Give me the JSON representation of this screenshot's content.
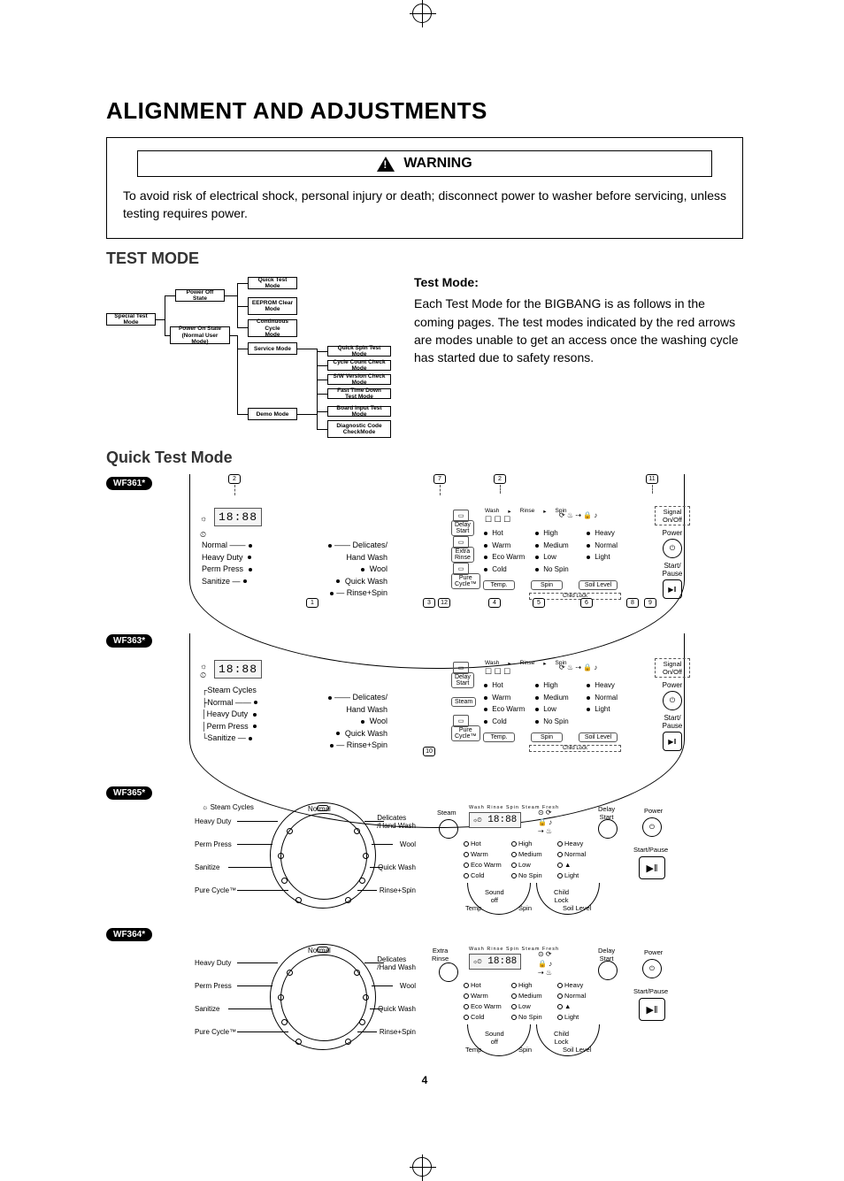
{
  "page": {
    "title": "ALIGNMENT AND ADJUSTMENTS",
    "warning_label": "WARNING",
    "warning_text": "To avoid risk of electrical shock, personal injury or death; disconnect power to washer before servicing, unless testing requires power.",
    "page_number": "4"
  },
  "sections": {
    "test_mode_heading": "TEST MODE",
    "quick_test_heading": "Quick Test Mode",
    "test_mode_sub": "Test Mode:",
    "test_mode_body": "Each Test Mode for the BIGBANG is as follows in the coming pages.  The test modes indicated by the red arrows are modes unable to get an access once the washing cycle has started due to safety resons."
  },
  "flow": {
    "special": "Special Test Mode",
    "power_off": "Power Off State",
    "power_on": "Power On State\n(Normal User Mode)",
    "quick": "Quick Test Mode",
    "eeprom": "EEPROM Clear\nMode",
    "continuous": "Continuous Cycle\nMode",
    "service": "Service Mode",
    "demo": "Demo Mode",
    "spin": "Quick Spin Test Mode",
    "cycle_count": "Cycle Count Check Mode",
    "sw_version": "S/W Version Check Mode",
    "fast_time": "Fast Time Down Test Mode",
    "board_input": "Board Input Test Mode",
    "diag": "Diagnostic Code\nCheckMode"
  },
  "models": {
    "m1": "WF361*",
    "m2": "WF363*",
    "m3": "WF365*",
    "m4": "WF364*"
  },
  "seg_display": "18:88",
  "cycles_left_a": [
    "Normal",
    "Heavy Duty",
    "Perm Press",
    "Sanitize"
  ],
  "cycles_right_a": [
    "Delicates/\nHand Wash",
    "Wool",
    "Quick Wash",
    "Rinse+Spin"
  ],
  "cycles_left_b": [
    "Steam Cycles",
    "Normal",
    "Heavy Duty",
    "Perm Press",
    "Sanitize"
  ],
  "knob_labels_c": {
    "top": "Steam Cycles",
    "left": [
      "Heavy Duty",
      "Perm Press",
      "Sanitize",
      "Pure Cycle™"
    ],
    "center": "Normal",
    "right": [
      "Delicates\n/Hand Wash",
      "Wool",
      "Quick Wash",
      "Rinse+Spin"
    ]
  },
  "knob_labels_d": {
    "left": [
      "Heavy Duty",
      "Perm Press",
      "Sanitize",
      "Pure Cycle™"
    ],
    "center": "Normal",
    "right": [
      "Delicates\n/Hand Wash",
      "Wool",
      "Quick Wash",
      "Rinse+Spin"
    ]
  },
  "right1": {
    "delay": "Delay\nStart",
    "extra_rinse": "Extra\nRinse",
    "pure_cycle": "Pure\nCycle™",
    "steam": "Steam",
    "proc": [
      "Wash",
      "Rinse",
      "Spin"
    ],
    "temp_col": [
      "Hot",
      "Warm",
      "Eco Warm",
      "Cold"
    ],
    "spin_col": [
      "High",
      "Medium",
      "Low",
      "No Spin"
    ],
    "soil_col": [
      "Heavy",
      "Normal",
      "Light"
    ],
    "temp_btn": "Temp.",
    "spin_btn": "Spin",
    "soil_btn": "Soil Level",
    "signal": "Signal\nOn/Off",
    "power": "Power",
    "start": "Start/\nPause",
    "child": "Child Lock"
  },
  "right2": {
    "extra_rinse": "Extra\nRinse",
    "steam": "Steam",
    "delay": "Delay\nStart",
    "power": "Power",
    "start": "Start/Pause",
    "temp": "Temp.",
    "spin": "Spin",
    "soil": "Soil Level",
    "sound": "Sound\noff",
    "child": "Child\nLock",
    "temp_opts": [
      "Hot",
      "Warm",
      "Eco Warm",
      "Cold"
    ],
    "spin_opts": [
      "High",
      "Medium",
      "Low",
      "No Spin"
    ],
    "soil_opts": [
      "Heavy",
      "Normal",
      "▲",
      "Light"
    ],
    "proc": [
      "Wash",
      "Rinse",
      "Spin",
      "Steam",
      "Fresh"
    ]
  },
  "callouts": [
    "1",
    "2",
    "3",
    "4",
    "5",
    "6",
    "7",
    "8",
    "9",
    "10",
    "11",
    "12"
  ]
}
